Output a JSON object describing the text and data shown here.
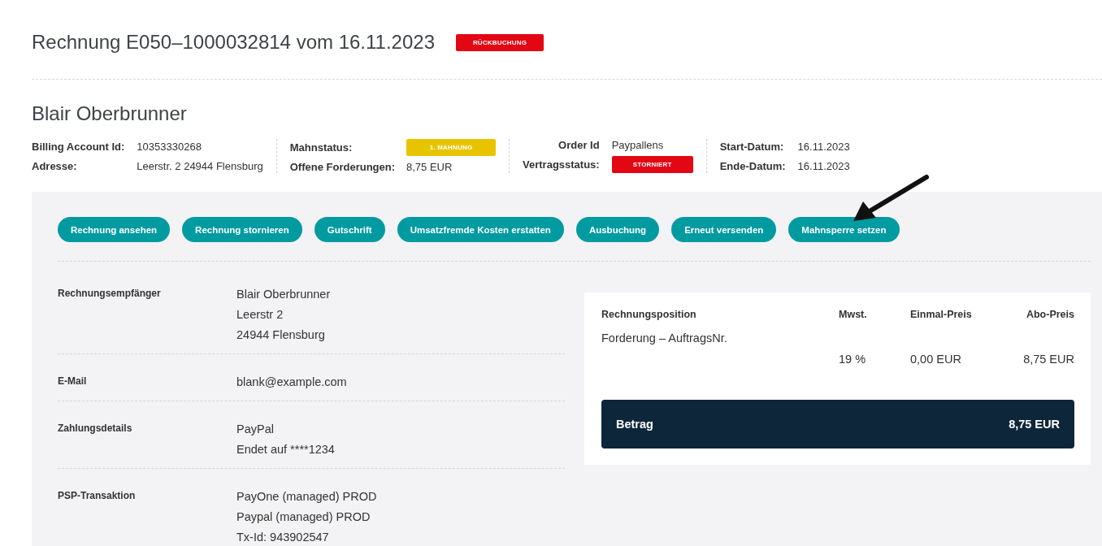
{
  "header": {
    "title": "Rechnung E050–1000032814 vom 16.11.2023",
    "badge": {
      "label": "RÜCKBUCHUNG",
      "color": "#e30613"
    }
  },
  "customer": {
    "name": "Blair Oberbrunner"
  },
  "info_groups": [
    {
      "fields": [
        {
          "label": "Billing Account Id:",
          "kind": "text",
          "value": "10353330268"
        },
        {
          "label": "Adresse:",
          "kind": "text",
          "value": "Leerstr. 2 24944 Flensburg"
        }
      ]
    },
    {
      "fields": [
        {
          "label": "Mahnstatus:",
          "kind": "badge",
          "value": "1. MAHNUNG",
          "color": "#e8c400"
        },
        {
          "label": "Offene Forderungen:",
          "kind": "text",
          "value": "8,75 EUR"
        }
      ]
    },
    {
      "fields": [
        {
          "label": "Order Id",
          "kind": "text",
          "value": "Paypallens"
        },
        {
          "label": "Vertragsstatus:",
          "kind": "badge",
          "value": "STORNIERT",
          "color": "#e30613"
        }
      ]
    },
    {
      "fields": [
        {
          "label": "Start-Datum:",
          "kind": "text",
          "value": "16.11.2023"
        },
        {
          "label": "Ende-Datum:",
          "kind": "text",
          "value": "16.11.2023"
        }
      ]
    }
  ],
  "actions": [
    "Rechnung ansehen",
    "Rechnung stornieren",
    "Gutschrift",
    "Umsatzfremde Kosten erstatten",
    "Ausbuchung",
    "Erneut versenden",
    "Mahnsperre setzen"
  ],
  "details": [
    {
      "label": "Rechnungsempfänger",
      "lines": [
        "Blair Oberbrunner",
        "Leerstr 2",
        "24944 Flensburg"
      ]
    },
    {
      "label": "E-Mail",
      "lines": [
        "blank@example.com"
      ]
    },
    {
      "label": "Zahlungsdetails",
      "lines": [
        "PayPal",
        "Endet auf ****1234"
      ]
    },
    {
      "label": "PSP-Transaktion",
      "lines": [
        "PayOne (managed) PROD",
        "Paypal (managed) PROD",
        "Tx-Id: 943902547"
      ]
    }
  ],
  "invoice_table": {
    "columns": [
      "Rechnungsposition",
      "Mwst.",
      "Einmal-Preis",
      "Abo-Preis"
    ],
    "rows": [
      {
        "position": "Forderung – AuftragsNr.",
        "vat": "19 %",
        "one_time": "0,00 EUR",
        "subscription": "8,75 EUR"
      }
    ],
    "total": {
      "label": "Betrag",
      "value": "8,75 EUR"
    }
  }
}
